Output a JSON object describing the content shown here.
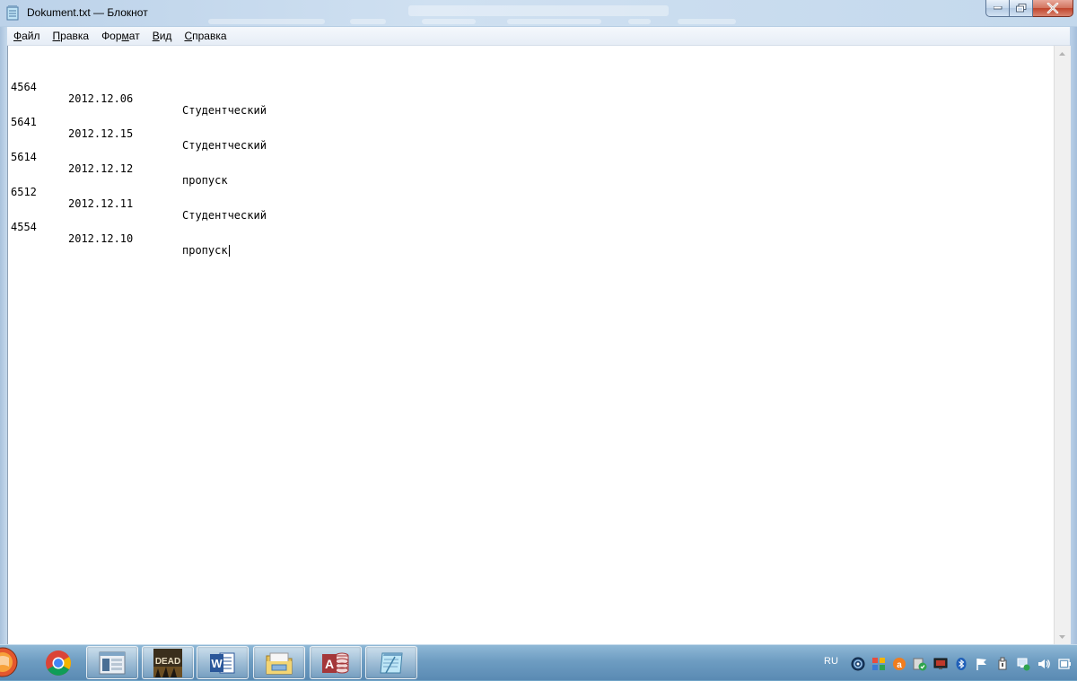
{
  "window": {
    "title": "Dokument.txt — Блокнот"
  },
  "menu": [
    {
      "label": "Файл",
      "access": "Ф",
      "rest": "айл"
    },
    {
      "label": "Правка",
      "access": "П",
      "rest": "равка"
    },
    {
      "label": "Формат",
      "pre": "Фор",
      "access": "м",
      "rest": "ат"
    },
    {
      "label": "Вид",
      "access": "В",
      "rest": "ид"
    },
    {
      "label": "Справка",
      "access": "С",
      "rest": "правка"
    }
  ],
  "document": {
    "lines": [
      {
        "id": "4564",
        "date": "2012.12.06",
        "type": "Студентческий"
      },
      {
        "id": "5641",
        "date": "2012.12.15",
        "type": "Студентческий"
      },
      {
        "id": "5614",
        "date": "2012.12.12",
        "type": "пропуск"
      },
      {
        "id": "6512",
        "date": "2012.12.11",
        "type": "Студентческий"
      },
      {
        "id": "4554",
        "date": "2012.12.10",
        "type": "пропуск"
      }
    ]
  },
  "taskbar": {
    "apps": [
      {
        "name": "chrome-icon"
      },
      {
        "name": "window-preview-icon"
      },
      {
        "name": "the-walking-dead-icon",
        "label": "DEAD"
      },
      {
        "name": "word-icon",
        "label": "W"
      },
      {
        "name": "file-explorer-icon"
      },
      {
        "name": "access-icon",
        "label": "A"
      },
      {
        "name": "notepad-icon",
        "active": true
      }
    ],
    "tray": {
      "language": "RU"
    }
  },
  "colors": {
    "word": "#2b579a",
    "access": "#a4373a",
    "chrome_red": "#db4437",
    "chrome_green": "#0f9d58",
    "chrome_yellow": "#f4b400",
    "chrome_blue": "#4285f4"
  }
}
